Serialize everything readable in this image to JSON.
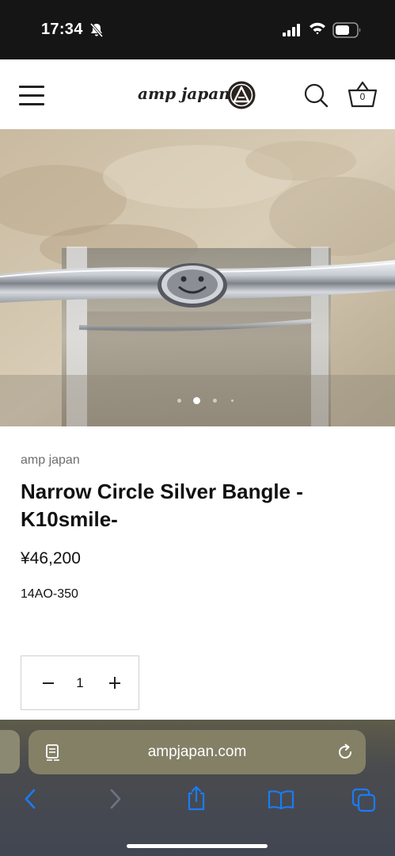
{
  "status_bar": {
    "time": "17:34",
    "icons": [
      "bell-slash-icon",
      "cellular-signal-icon",
      "wifi-icon",
      "battery-icon"
    ]
  },
  "header": {
    "logo_text": "amp japan",
    "logo_mark": "amp-japan-emblem",
    "cart_count": "0",
    "icons": [
      "hamburger-menu-icon",
      "search-icon",
      "shopping-basket-icon"
    ]
  },
  "gallery": {
    "image": "silver bangle with smile emblem on acrylic stand",
    "slide_count": 4,
    "active_slide": 2
  },
  "product": {
    "vendor": "amp japan",
    "title": "Narrow Circle Silver Bangle - K10smile-",
    "price": "¥46,200",
    "sku": "14AO-350",
    "quantity": "1"
  },
  "browser": {
    "url": "ampjapan.com",
    "icons": [
      "reader-mode-icon",
      "reload-icon",
      "back-icon",
      "forward-icon",
      "share-icon",
      "bookmarks-icon",
      "tabs-icon"
    ],
    "colors": {
      "toolbar_icon": "#1a7cf5",
      "disabled_icon": "#6f7482"
    }
  }
}
